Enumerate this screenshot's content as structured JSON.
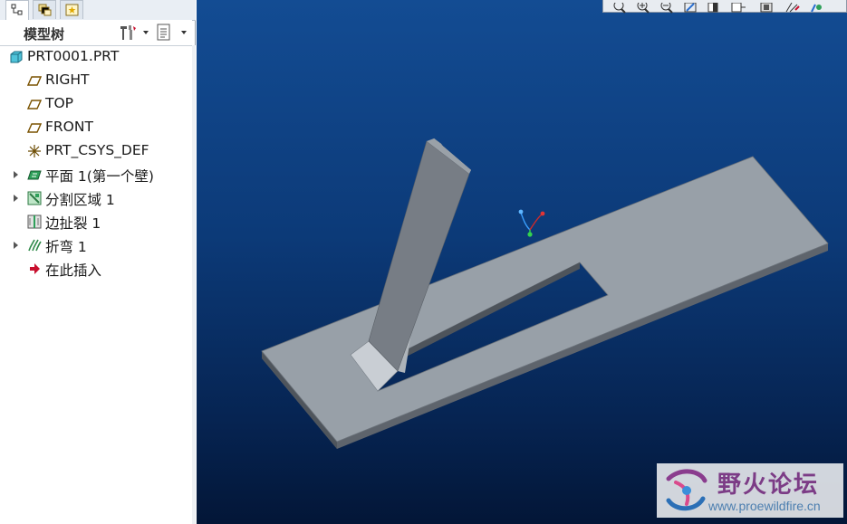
{
  "panel": {
    "tabs": [
      {
        "name": "model-tree-tab",
        "icon": "tree-icon",
        "active": true
      },
      {
        "name": "folder-browser-tab",
        "icon": "layers-icon",
        "active": false
      },
      {
        "name": "favorites-tab",
        "icon": "star-icon",
        "active": false
      }
    ],
    "title": "模型树",
    "settings_icon": "tools-icon",
    "show_icon": "list-icon"
  },
  "tree": {
    "items": [
      {
        "label": "PRT0001.PRT",
        "icon": "part-icon",
        "expandable": false,
        "indent": 0
      },
      {
        "label": "RIGHT",
        "icon": "datum-plane-icon",
        "expandable": false,
        "indent": 1
      },
      {
        "label": "TOP",
        "icon": "datum-plane-icon",
        "expandable": false,
        "indent": 1
      },
      {
        "label": "FRONT",
        "icon": "datum-plane-icon",
        "expandable": false,
        "indent": 1
      },
      {
        "label": "PRT_CSYS_DEF",
        "icon": "csys-icon",
        "expandable": false,
        "indent": 1
      },
      {
        "label": "平面 1(第一个壁)",
        "icon": "flat-wall-icon",
        "expandable": true,
        "indent": 1
      },
      {
        "label": "分割区域 1",
        "icon": "split-area-icon",
        "expandable": true,
        "indent": 1
      },
      {
        "label": "边扯裂 1",
        "icon": "edge-rip-icon",
        "expandable": false,
        "indent": 1
      },
      {
        "label": "折弯 1",
        "icon": "bend-icon",
        "expandable": true,
        "indent": 1
      },
      {
        "label": "在此插入",
        "icon": "insert-here-icon",
        "expandable": false,
        "indent": 1
      }
    ]
  },
  "toolbar": {
    "buttons": [
      "refit-icon",
      "zoom-in-icon",
      "zoom-out-icon",
      "repaint-icon",
      "shading-icon",
      "saved-views-icon",
      "layers-icon",
      "datum-display-icon",
      "spin-center-icon"
    ]
  },
  "watermark": {
    "title": "野火论坛",
    "url": "www.proewildfire.cn"
  },
  "colors": {
    "viewport_top": "#134c93",
    "viewport_bottom": "#031637",
    "part_top": "#98a0a8",
    "part_side": "#5a6068",
    "wall_face": "#777d85"
  }
}
